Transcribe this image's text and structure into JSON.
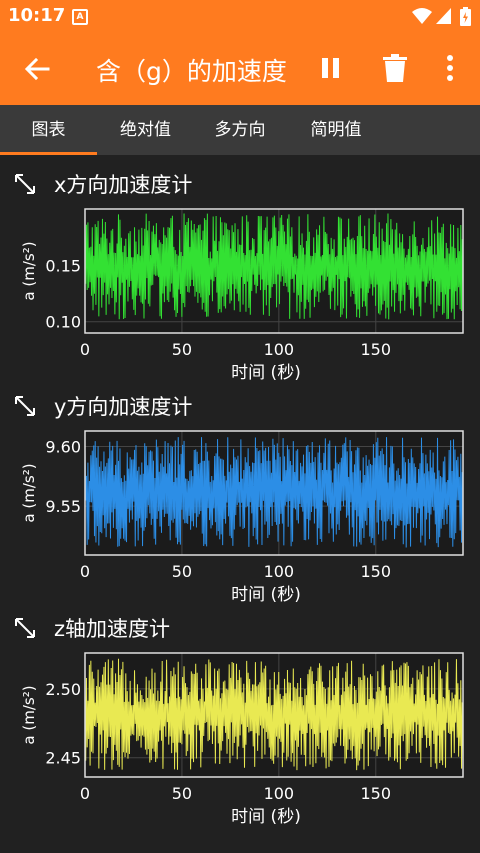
{
  "status_bar": {
    "time": "10:17",
    "notification_label": "A"
  },
  "toolbar": {
    "title": "含（g）的加速度"
  },
  "tabs": [
    {
      "label": "图表",
      "active": true
    },
    {
      "label": "绝对值",
      "active": false
    },
    {
      "label": "多方向",
      "active": false
    },
    {
      "label": "简明值",
      "active": false
    }
  ],
  "colors": {
    "accent": "#ff7b1f",
    "x": "#33e133",
    "y": "#2c8ee6",
    "z": "#e9e952"
  },
  "chart_data": [
    {
      "type": "line",
      "title": "x方向加速度计",
      "xlabel": "时间 (秒)",
      "ylabel": "a (m/s²)",
      "xlim": [
        0,
        195
      ],
      "ylim": [
        0.09,
        0.2
      ],
      "xticks": [
        0,
        50,
        100,
        150
      ],
      "xtick_labels": [
        "0",
        "50",
        "100",
        "150"
      ],
      "yticks": [
        0.1,
        0.15
      ],
      "ytick_labels": [
        "0.10",
        "0.15"
      ],
      "series": [
        {
          "color": "#33e133",
          "noise": {
            "low": 0.102,
            "high": 0.196,
            "center": 0.149
          }
        }
      ]
    },
    {
      "type": "line",
      "title": "y方向加速度计",
      "xlabel": "时间 (秒)",
      "ylabel": "a (m/s²)",
      "xlim": [
        0,
        195
      ],
      "ylim": [
        9.509,
        9.613
      ],
      "xticks": [
        0,
        50,
        100,
        150
      ],
      "xtick_labels": [
        "0",
        "50",
        "100",
        "150"
      ],
      "yticks": [
        9.55,
        9.6
      ],
      "ytick_labels": [
        "9.55",
        "9.60"
      ],
      "series": [
        {
          "color": "#2c8ee6",
          "noise": {
            "low": 9.515,
            "high": 9.608,
            "center": 9.562
          }
        }
      ]
    },
    {
      "type": "line",
      "title": "z轴加速度计",
      "xlabel": "时间 (秒)",
      "ylabel": "a (m/s²)",
      "xlim": [
        0,
        195
      ],
      "ylim": [
        2.436,
        2.526
      ],
      "xticks": [
        0,
        50,
        100,
        150
      ],
      "xtick_labels": [
        "0",
        "50",
        "100",
        "150"
      ],
      "yticks": [
        2.45,
        2.5
      ],
      "ytick_labels": [
        "2.45",
        "2.50"
      ],
      "series": [
        {
          "color": "#e9e952",
          "noise": {
            "low": 2.441,
            "high": 2.522,
            "center": 2.482
          }
        }
      ]
    }
  ]
}
